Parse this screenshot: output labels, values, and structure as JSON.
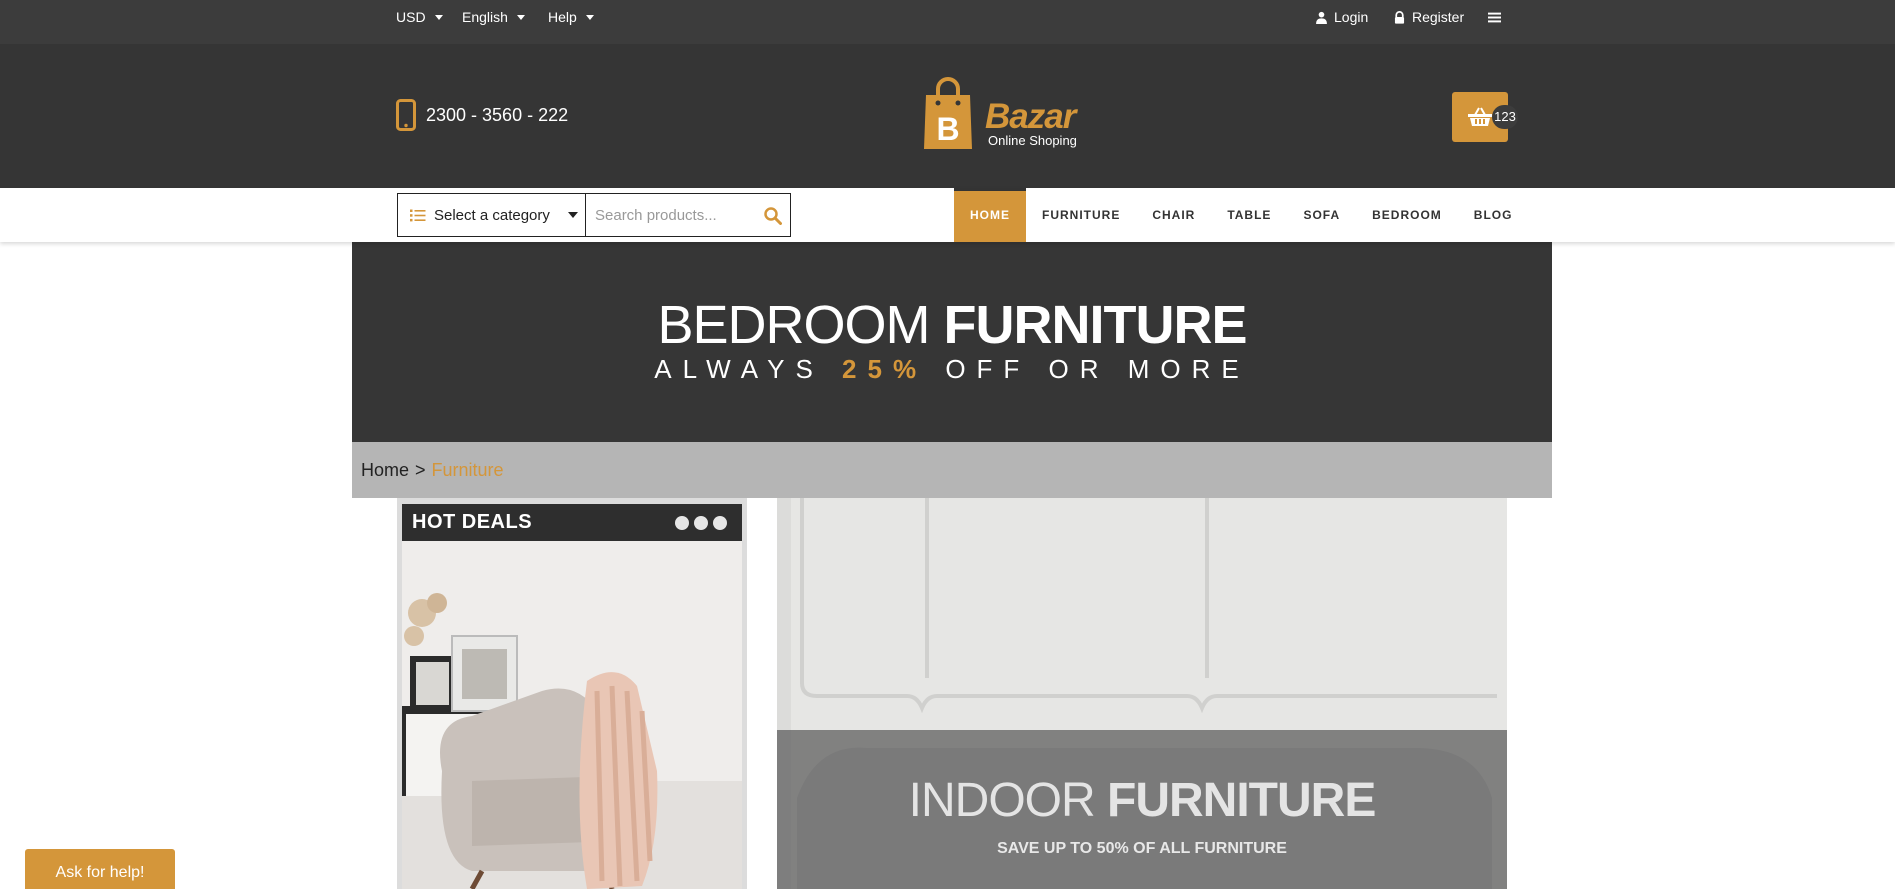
{
  "topbar": {
    "currency": "USD",
    "language": "English",
    "help": "Help",
    "login": "Login",
    "register": "Register",
    "icons": {
      "login": "user-icon",
      "register": "lock-icon",
      "menu": "hamburger-icon"
    }
  },
  "header": {
    "phone": "2300 - 3560 - 222",
    "logo": {
      "brand": "Bazar",
      "tagline": "Online Shoping",
      "letter": "B"
    },
    "cart_count": "123"
  },
  "nav": {
    "category_label": "Select a category",
    "search_placeholder": "Search products...",
    "menu": [
      "HOME",
      "FURNITURE",
      "CHAIR",
      "TABLE",
      "SOFA",
      "BEDROOM",
      "BLOG"
    ],
    "active": "HOME"
  },
  "hero": {
    "title_light": "BEDROOM",
    "title_bold": "FURNITURE",
    "sub_before": "ALWAYS",
    "sub_accent": "25%",
    "sub_after": "OFF OR MORE"
  },
  "breadcrumb": {
    "home": "Home",
    "separator": ">",
    "current": "Furniture"
  },
  "deals": {
    "title": "HOT DEALS",
    "dot_count": 3
  },
  "promo": {
    "title_light": "INDOOR",
    "title_bold": "FURNITURE",
    "subtitle": "SAVE UP TO 50% OF ALL FURNITURE"
  },
  "help_button": "Ask for help!",
  "colors": {
    "accent": "#d4963a",
    "topbar": "#3c3c3c",
    "header": "#353535",
    "hero": "#363636",
    "breadcrumb": "#b5b5b5"
  }
}
